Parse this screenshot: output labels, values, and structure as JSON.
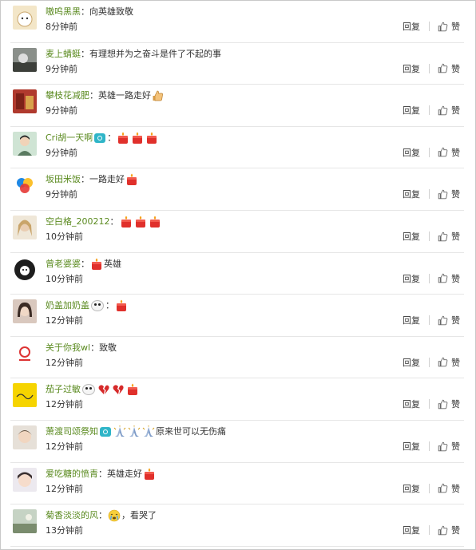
{
  "labels": {
    "reply": "回复",
    "like": "赞"
  },
  "comments": [
    {
      "user": "嗷呜黑黑",
      "sep": "：",
      "text": "向英雄致敬",
      "emojis": [],
      "badges": [],
      "time": "8分钟前",
      "avatar": "cat-avatar"
    },
    {
      "user": "麦上蜻蜓",
      "sep": "：",
      "text": "有理想并为之奋斗是件了不起的事",
      "emojis": [],
      "badges": [],
      "time": "9分钟前",
      "avatar": "animal-avatar"
    },
    {
      "user": "攀枝花减肥",
      "sep": "：",
      "text": "英雄一路走好",
      "emojis": [
        "thumbs-up"
      ],
      "badges": [],
      "time": "9分钟前",
      "avatar": "book-avatar"
    },
    {
      "user": "Cri胡一天啊",
      "sep": "：",
      "text": "",
      "emojis": [
        "candle",
        "candle",
        "candle"
      ],
      "badges": [
        "camera-badge"
      ],
      "time": "9分钟前",
      "avatar": "portrait-avatar"
    },
    {
      "user": "坂田米饭",
      "sep": "：",
      "text": "一路走好",
      "emojis": [
        "candle"
      ],
      "badges": [],
      "time": "9分钟前",
      "avatar": "circles-avatar"
    },
    {
      "user": "空白格_200212",
      "sep": "：",
      "text": "",
      "emojis": [
        "candle",
        "candle",
        "candle"
      ],
      "badges": [],
      "time": "10分钟前",
      "avatar": "girl-avatar"
    },
    {
      "user": "曾老婆婆",
      "sep": "：",
      "text": "英雄",
      "emojis": [
        "candle"
      ],
      "badges": [],
      "time": "10分钟前",
      "avatar": "dark-avatar"
    },
    {
      "user": "奶盖加奶盖",
      "sep": "：",
      "text": "",
      "emojis": [
        "candle"
      ],
      "badges": [
        "panda"
      ],
      "time": "12分钟前",
      "avatar": "woman-avatar"
    },
    {
      "user": "关于你我wl",
      "sep": "：",
      "text": "致敬",
      "emojis": [],
      "badges": [],
      "time": "12分钟前",
      "avatar": "logo-avatar"
    },
    {
      "user": "茄子过敏",
      "sep": "",
      "text": "",
      "emojis": [
        "broken-heart",
        "broken-heart",
        "candle"
      ],
      "badges": [
        "panda"
      ],
      "time": "12分钟前",
      "avatar": "yellow-avatar"
    },
    {
      "user": "萧渡司颂祭知",
      "sep": "",
      "text": "原来世可以无伤痛",
      "emojis": [
        "pray",
        "pray",
        "pray"
      ],
      "badges": [
        "camera-badge"
      ],
      "time": "12分钟前",
      "avatar": "face-avatar"
    },
    {
      "user": "爱吃糖的愤青",
      "sep": "：",
      "text": "英雄走好",
      "emojis": [
        "candle"
      ],
      "badges": [],
      "time": "12分钟前",
      "avatar": "child-avatar"
    },
    {
      "user": "菊香淡淡的风",
      "sep": "：",
      "text": "，看哭了",
      "emojis": [
        "crying-face"
      ],
      "badges": [],
      "time": "13分钟前",
      "avatar": "landscape-avatar"
    }
  ],
  "colors": {
    "username": "#5a8a1f",
    "text": "#333333",
    "divider": "#e6e6e6",
    "candle": "#e0302b"
  }
}
